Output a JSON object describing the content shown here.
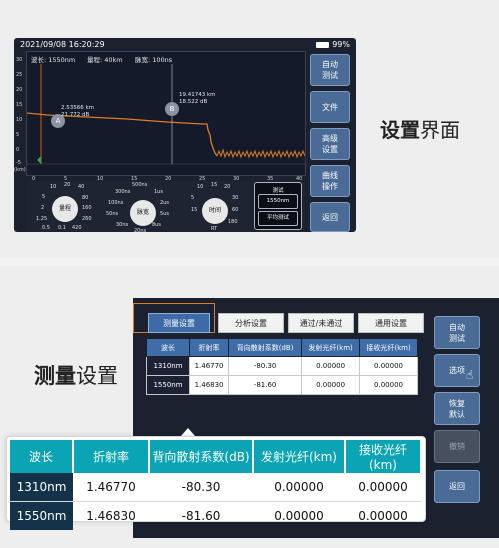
{
  "top": {
    "heading": {
      "bold": "设置",
      "normal": "界面"
    },
    "status": {
      "datetime": "2021/09/08 16:20:29",
      "battery": "99%"
    },
    "info": {
      "wavelength": "波长: 1550nm",
      "range": "量程: 40km",
      "pulse": "脉宽: 100ns"
    },
    "y_ticks": [
      "30",
      "25",
      "20",
      "15",
      "10",
      "5",
      "0",
      "-5"
    ],
    "x_ticks": [
      "0",
      "5",
      "10",
      "15",
      "20",
      "25",
      "30",
      "35",
      "40"
    ],
    "x_unit": "(km)",
    "marker_a": {
      "label": "A",
      "text1": "2.53566 km",
      "text2": "21.772 dB"
    },
    "marker_b": {
      "label": "B",
      "text1": "19.41743 km",
      "text2": "18.522 dB"
    },
    "side_buttons": [
      {
        "line1": "自动",
        "line2": "测试"
      },
      {
        "line1": "文件",
        "line2": ""
      },
      {
        "line1": "高级",
        "line2": "设置"
      },
      {
        "line1": "曲线",
        "line2": "操作"
      },
      {
        "line1": "返回",
        "line2": ""
      }
    ],
    "dial1": {
      "center": "量程",
      "labels": [
        "10",
        "20",
        "40",
        "5",
        "80",
        "2",
        "160",
        "1.25",
        "260",
        "0.5",
        "0.1",
        "420"
      ]
    },
    "dial2": {
      "center": "脉宽",
      "labels": [
        "500ns",
        "300ns",
        "1us",
        "100ns",
        "2us",
        "50ns",
        "5us",
        "30ns",
        "8us",
        "20ns"
      ]
    },
    "dial3": {
      "center": "时间",
      "labels": [
        "10",
        "15",
        "20",
        "30",
        "5",
        "60",
        "15",
        "180",
        "RT"
      ]
    },
    "selector": {
      "top": "测试",
      "mid": "1550nm",
      "bottom": "平均测试"
    }
  },
  "bottom": {
    "heading": {
      "bold": "测量",
      "normal": "设置"
    },
    "tabs": [
      "测量设置",
      "分析设置",
      "通过/未通过",
      "通用设置"
    ],
    "small_table": {
      "headers": [
        "波长",
        "折射率",
        "背向散射系数(dB)",
        "发射光纤(km)",
        "接收光纤(km)"
      ],
      "rows": [
        [
          "1310nm",
          "1.46770",
          "-80.30",
          "0.00000",
          "0.00000"
        ],
        [
          "1550nm",
          "1.46830",
          "-81.60",
          "0.00000",
          "0.00000"
        ]
      ]
    },
    "side_buttons": [
      {
        "line1": "自动",
        "line2": "测试"
      },
      {
        "line1": "选项",
        "line2": ""
      },
      {
        "line1": "恢复",
        "line2": "默认"
      },
      {
        "line1": "撤销",
        "line2": ""
      },
      {
        "line1": "返回",
        "line2": ""
      }
    ],
    "big_table": {
      "headers": [
        "波长",
        "折射率",
        "背向散射系数(dB)",
        "发射光纤(km)",
        "接收光纤(km)"
      ],
      "rows": [
        [
          "1310nm",
          "1.46770",
          "-80.30",
          "0.00000",
          "0.00000"
        ],
        [
          "1550nm",
          "1.46830",
          "-81.60",
          "0.00000",
          "0.00000"
        ]
      ]
    }
  }
}
